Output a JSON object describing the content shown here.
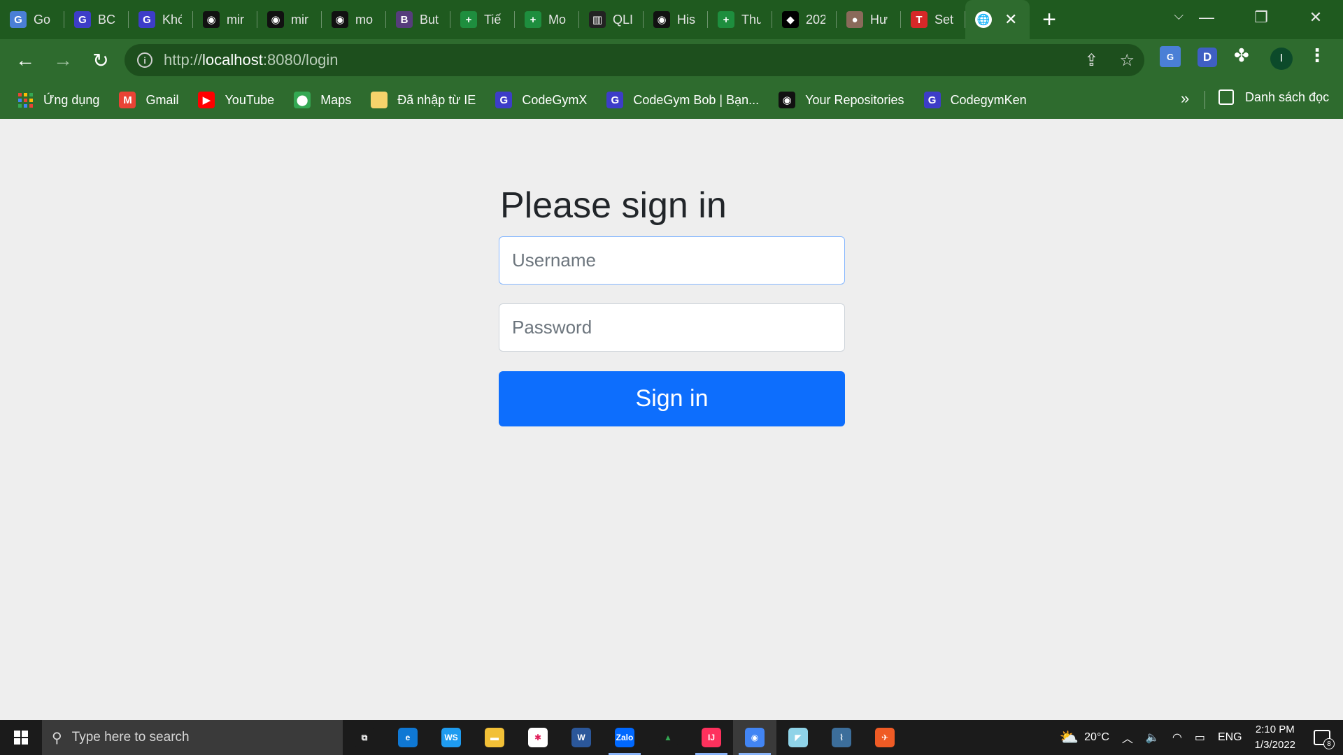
{
  "tabs": [
    {
      "title": "Go",
      "icon": "google-translate-icon",
      "color": "#4a7fd6",
      "glyph": "G"
    },
    {
      "title": "BC",
      "icon": "codegym-icon",
      "color": "#3d3dc8",
      "glyph": "G"
    },
    {
      "title": "Khó",
      "icon": "codegym-icon",
      "color": "#3d3dc8",
      "glyph": "G"
    },
    {
      "title": "mir",
      "icon": "github-icon",
      "color": "#111111",
      "glyph": "◉"
    },
    {
      "title": "mir",
      "icon": "github-icon",
      "color": "#111111",
      "glyph": "◉"
    },
    {
      "title": "mo",
      "icon": "github-icon",
      "color": "#111111",
      "glyph": "◉"
    },
    {
      "title": "But",
      "icon": "bootstrap-icon",
      "color": "#563d7c",
      "glyph": "B"
    },
    {
      "title": "Tiế",
      "icon": "sheets-plus-icon",
      "color": "#1e8e3e",
      "glyph": "+"
    },
    {
      "title": "Mo",
      "icon": "sheets-plus-icon",
      "color": "#1e8e3e",
      "glyph": "+"
    },
    {
      "title": "QLI",
      "icon": "trello-icon",
      "color": "#222222",
      "glyph": "▥"
    },
    {
      "title": "His",
      "icon": "github-icon",
      "color": "#111111",
      "glyph": "◉"
    },
    {
      "title": "Thu",
      "icon": "sheets-plus-icon",
      "color": "#1e8e3e",
      "glyph": "+"
    },
    {
      "title": "202",
      "icon": "bird-icon",
      "color": "#000000",
      "glyph": "◆"
    },
    {
      "title": "Hư",
      "icon": "image-thumb-icon",
      "color": "#8a6a5a",
      "glyph": "●"
    },
    {
      "title": "Set",
      "icon": "t-logo-icon",
      "color": "#d62828",
      "glyph": "T"
    }
  ],
  "active_tab": {
    "icon": "globe-icon",
    "close": "✕"
  },
  "window_controls": {
    "tab_search": "⌵",
    "minimize": "—",
    "restore": "❐",
    "close": "✕"
  },
  "address": {
    "scheme": "http://",
    "host": "localhost",
    "rest": ":8080/login"
  },
  "extensions": {
    "translate": "G",
    "d": "D",
    "avatar": "I"
  },
  "bookmarks": [
    {
      "label": "Ứng dụng",
      "icon": "apps-grid-icon"
    },
    {
      "label": "Gmail",
      "icon": "gmail-icon",
      "color": "#ea4335",
      "glyph": "M"
    },
    {
      "label": "YouTube",
      "icon": "youtube-icon",
      "color": "#ff0000",
      "glyph": "▶"
    },
    {
      "label": "Maps",
      "icon": "maps-icon",
      "color": "#34a853",
      "glyph": "⬤"
    },
    {
      "label": "Đã nhập từ IE",
      "icon": "folder-icon",
      "color": "#f6d36b",
      "glyph": ""
    },
    {
      "label": "CodeGymX",
      "icon": "codegym-icon",
      "color": "#3d3dc8",
      "glyph": "G"
    },
    {
      "label": "CodeGym Bob | Bạn...",
      "icon": "codegym-icon",
      "color": "#3d3dc8",
      "glyph": "G"
    },
    {
      "label": "Your Repositories",
      "icon": "github-icon",
      "color": "#111111",
      "glyph": "◉"
    },
    {
      "label": "CodegymKen",
      "icon": "codegym-icon",
      "color": "#3d3dc8",
      "glyph": "G"
    }
  ],
  "bookmarks_more": "»",
  "reading_list": "Danh sách đọc",
  "page": {
    "heading": "Please sign in",
    "username_placeholder": "Username",
    "password_placeholder": "Password",
    "submit_label": "Sign in"
  },
  "taskbar": {
    "search_placeholder": "Type here to search",
    "apps": [
      {
        "name": "task-view-icon",
        "color": "#1b1b1b",
        "glyph": "⧉",
        "running": false
      },
      {
        "name": "edge-icon",
        "color": "#0f78d4",
        "glyph": "e",
        "running": false
      },
      {
        "name": "webstorm-icon",
        "color": "#1f9cf0",
        "glyph": "WS",
        "running": false
      },
      {
        "name": "file-explorer-icon",
        "color": "#f2c037",
        "glyph": "▬",
        "running": false
      },
      {
        "name": "slack-icon",
        "color": "#ffffff",
        "glyph": "✱",
        "running": false
      },
      {
        "name": "word-icon",
        "color": "#2b579a",
        "glyph": "W",
        "running": false
      },
      {
        "name": "zalo-icon",
        "color": "#0068ff",
        "glyph": "Zalo",
        "running": true
      },
      {
        "name": "google-drive-icon",
        "color": "#1b1b1b",
        "glyph": "▲",
        "running": false
      },
      {
        "name": "intellij-icon",
        "color": "#fe315d",
        "glyph": "IJ",
        "running": true
      },
      {
        "name": "chrome-icon",
        "color": "#4285f4",
        "glyph": "◉",
        "running": true,
        "active": true
      },
      {
        "name": "notes-app-icon",
        "color": "#8fd3e8",
        "glyph": "◤",
        "running": false
      },
      {
        "name": "mysql-workbench-icon",
        "color": "#3c6e9b",
        "glyph": "⌇",
        "running": false
      },
      {
        "name": "postman-icon",
        "color": "#ef5b25",
        "glyph": "✈",
        "running": false
      }
    ],
    "weather": "20°C",
    "language": "ENG",
    "time": "2:10 PM",
    "date": "1/3/2022",
    "notification_count": "8"
  }
}
